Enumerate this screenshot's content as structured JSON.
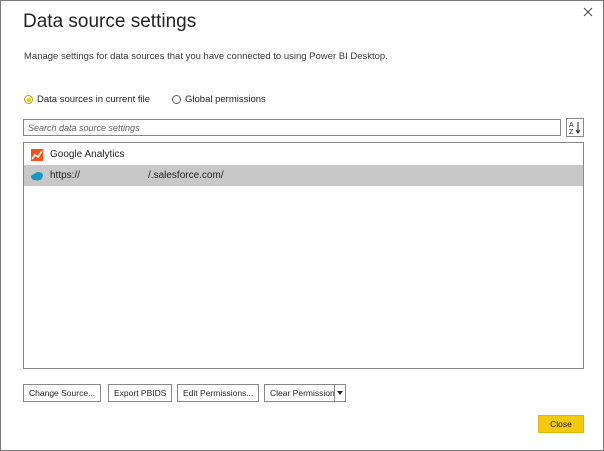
{
  "dialog": {
    "title": "Data source settings",
    "subtitle": "Manage settings for data sources that you have connected to using Power BI Desktop."
  },
  "scope": {
    "options": [
      {
        "label": "Data sources in current file",
        "selected": true
      },
      {
        "label": "Global permissions",
        "selected": false
      }
    ]
  },
  "search": {
    "placeholder": "Search data source settings",
    "value": ""
  },
  "sort_icon": "sort-az-icon",
  "sources": [
    {
      "label": "Google Analytics",
      "icon": "google-analytics-icon",
      "selected": false
    },
    {
      "prefix": "https://",
      "suffix": "/.salesforce.com/",
      "icon": "salesforce-cloud-icon",
      "selected": true
    }
  ],
  "buttons": {
    "change_source": "Change Source...",
    "export_pbids": "Export PBIDS",
    "edit_permissions": "Edit Permissions...",
    "clear_permissions": "Clear Permissions",
    "close": "Close"
  },
  "colors": {
    "accent": "#f2c811",
    "selection": "#c8c8c8"
  }
}
